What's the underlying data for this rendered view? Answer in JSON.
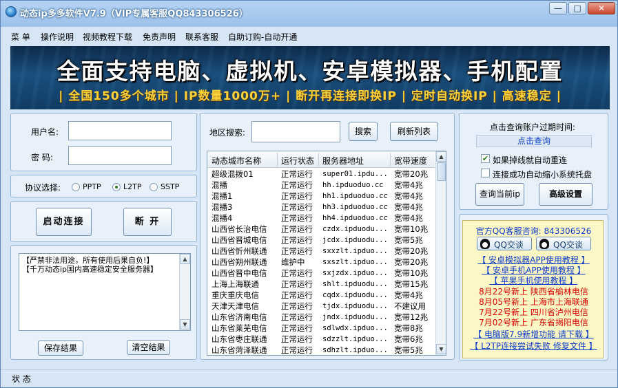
{
  "window": {
    "title": "动态ip多多软件V7.9（VIP专属客服QQ843306526）",
    "controls": {
      "minimize": "—",
      "maximize": "□",
      "close": "✕"
    }
  },
  "menu": [
    "菜 单",
    "操作说明",
    "视频教程下载",
    "免责声明",
    "联系客服",
    "自助订购-自动开通"
  ],
  "banner": {
    "title": "全面支持电脑、虚拟机、安卓模拟器、手机配置",
    "subtitle": "| 全国150多个城市 | IP数量1000万+ | 断开再连接即换IP | 定时自动换IP | 高速稳定 |"
  },
  "login": {
    "username_label": "用户名:",
    "username_value": "",
    "password_label": "密  码:",
    "password_value": ""
  },
  "protocol": {
    "label": "协议选择:",
    "options": [
      "PPTP",
      "L2TP",
      "SSTP"
    ],
    "selected": "L2TP"
  },
  "actions": {
    "connect": "启动连接",
    "disconnect": "断 开"
  },
  "log": {
    "lines": [
      "【严禁非法用途，所有使用后果自负!】",
      "【千万动态ip国内高速稳定安全服务器】"
    ],
    "save": "保存结果",
    "clear": "清空结果"
  },
  "search": {
    "label": "地区搜索:",
    "value": "",
    "search_button": "搜索",
    "refresh_button": "刷新列表"
  },
  "servers": {
    "columns": [
      "动态城市名称",
      "运行状态",
      "服务器地址",
      "宽带速度"
    ],
    "rows": [
      [
        "超级混拨01",
        "正常运行",
        "super01.ipdu...",
        "宽带20兆"
      ],
      [
        "混播",
        "正常运行",
        "hh.ipduoduo.cc",
        "宽带4兆"
      ],
      [
        "混播1",
        "正常运行",
        "hh1.ipduoduo.cc",
        "宽带4兆"
      ],
      [
        "混播3",
        "正常运行",
        "hh3.ipduoduo.cc",
        "宽带4兆"
      ],
      [
        "混播4",
        "正常运行",
        "hh4.ipduoduo.cc",
        "宽带4兆"
      ],
      [
        "山西省长治电信",
        "正常运行",
        "czdx.ipduodu...",
        "宽带10兆"
      ],
      [
        "山西省晋城电信",
        "正常运行",
        "jcdx.ipduodu...",
        "宽带5兆"
      ],
      [
        "山西省忻州联通",
        "正常运行",
        "sxxzlt.ipduo...",
        "宽带20兆"
      ],
      [
        "山西省朔州联通",
        "维护中",
        "sxszlt.ipduo...",
        "宽带20兆"
      ],
      [
        "山西省晋中电信",
        "正常运行",
        "sxjzdx.ipduo...",
        "宽带10兆"
      ],
      [
        "上海上海联通",
        "正常运行",
        "shlt.ipduodu...",
        "宽带15兆"
      ],
      [
        "重庆重庆电信",
        "正常运行",
        "cqdx.ipduodu...",
        "宽带4兆"
      ],
      [
        "天津天津电信",
        "正常运行",
        "tjdx.ipduodu...",
        "不建议用"
      ],
      [
        "山东省济南电信",
        "正常运行",
        "jndx.ipduodu...",
        "宽带12兆"
      ],
      [
        "山东省莱芜电信",
        "正常运行",
        "sdlwdx.ipduo...",
        "宽带8兆"
      ],
      [
        "山东省枣庄联通",
        "正常运行",
        "sdzzlt.ipduo...",
        "宽带6兆"
      ],
      [
        "山东省菏泽联通",
        "正常运行",
        "sdhzlt.ipduo...",
        "宽带5兆"
      ]
    ]
  },
  "account": {
    "expiry_label": "点击查询账户过期时间:",
    "query_link": "点击查询",
    "auto_reconnect": "如果掉线就自动重连",
    "auto_reconnect_checked": true,
    "minimize_tray": "连接成功自动缩小系统托盘",
    "minimize_tray_checked": false,
    "query_ip": "查询当前ip",
    "advanced": "高级设置"
  },
  "info": {
    "qq_service": "官方QQ客服咨询: 843306526",
    "qq_button_1": "QQ交谈",
    "qq_button_2": "QQ交谈",
    "links": [
      "【 安卓模拟器APP使用教程 】",
      "【 安卓手机APP使用教程 】",
      "【 苹果手机使用教程 】"
    ],
    "news": [
      "8月22号新上  陕西省榆林电信",
      "8月05号新上  上海市上海联通",
      "7月22号新上  四川省泸州电信",
      "7月02号新上  广东省揭阳电信"
    ],
    "update_line": "【 电脑版7.9新增功能  请下载 】",
    "l2tp_line": "【 L2TP连接尝试失败  修复文件 】"
  },
  "status": {
    "label": "状 态"
  },
  "colors": {
    "window_bg": "#d6e6f6",
    "panel_bg": "#e8f1fb",
    "link_blue": "#0a3ccc",
    "news_red": "#d40000",
    "banner_yellow": "#ffd23a",
    "info_bg": "#fdf7c6"
  }
}
